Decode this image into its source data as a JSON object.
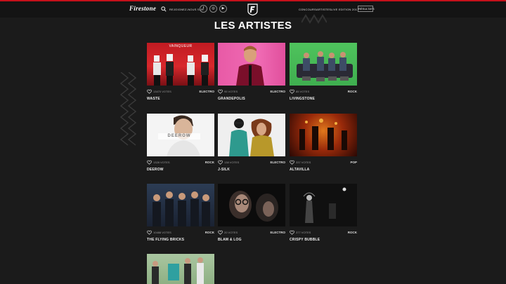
{
  "header": {
    "logo": "Firestone",
    "follow_label": "REJOIGNEZ-NOUS SUR",
    "social": [
      {
        "icon": "facebook-icon",
        "glyph": "f"
      },
      {
        "icon": "instagram-icon",
        "glyph": "◎"
      },
      {
        "icon": "youtube-icon",
        "glyph": "▶"
      }
    ],
    "nav": [
      "CONCOURS",
      "ARTISTES",
      "LIVE",
      "EDITION 2017"
    ],
    "results_button": "RÉSULTATS"
  },
  "page_title": "LES ARTISTES",
  "artists": [
    {
      "name": "WASTE",
      "votes": "13470 VOTES",
      "genre": "ELECTRO",
      "badge": "VAINQUEUR"
    },
    {
      "name": "GRANDEPOLIS",
      "votes": "95 VOTES",
      "genre": "ELECTRO"
    },
    {
      "name": "LIVINGSTONE",
      "votes": "85 VOTES",
      "genre": "ROCK"
    },
    {
      "name": "DEEROW",
      "votes": "1328 VOTES",
      "genre": "ROCK",
      "watermark": "DEEROW"
    },
    {
      "name": "J-SILK",
      "votes": "138 VOTES",
      "genre": "ELECTRO"
    },
    {
      "name": "ALTAVILLA",
      "votes": "337 VOTES",
      "genre": "POP"
    },
    {
      "name": "THE FLYING BRICKS",
      "votes": "10488 VOTES",
      "genre": "ROCK"
    },
    {
      "name": "BLAM & LOG",
      "votes": "20 VOTES",
      "genre": "ELECTRO"
    },
    {
      "name": "CRISPY BUBBLE",
      "votes": "377 VOTES",
      "genre": "ROCK"
    },
    {
      "name": "",
      "votes": "",
      "genre": ""
    }
  ],
  "colors": {
    "accent": "#c4101a",
    "background": "#1b1b1b"
  }
}
